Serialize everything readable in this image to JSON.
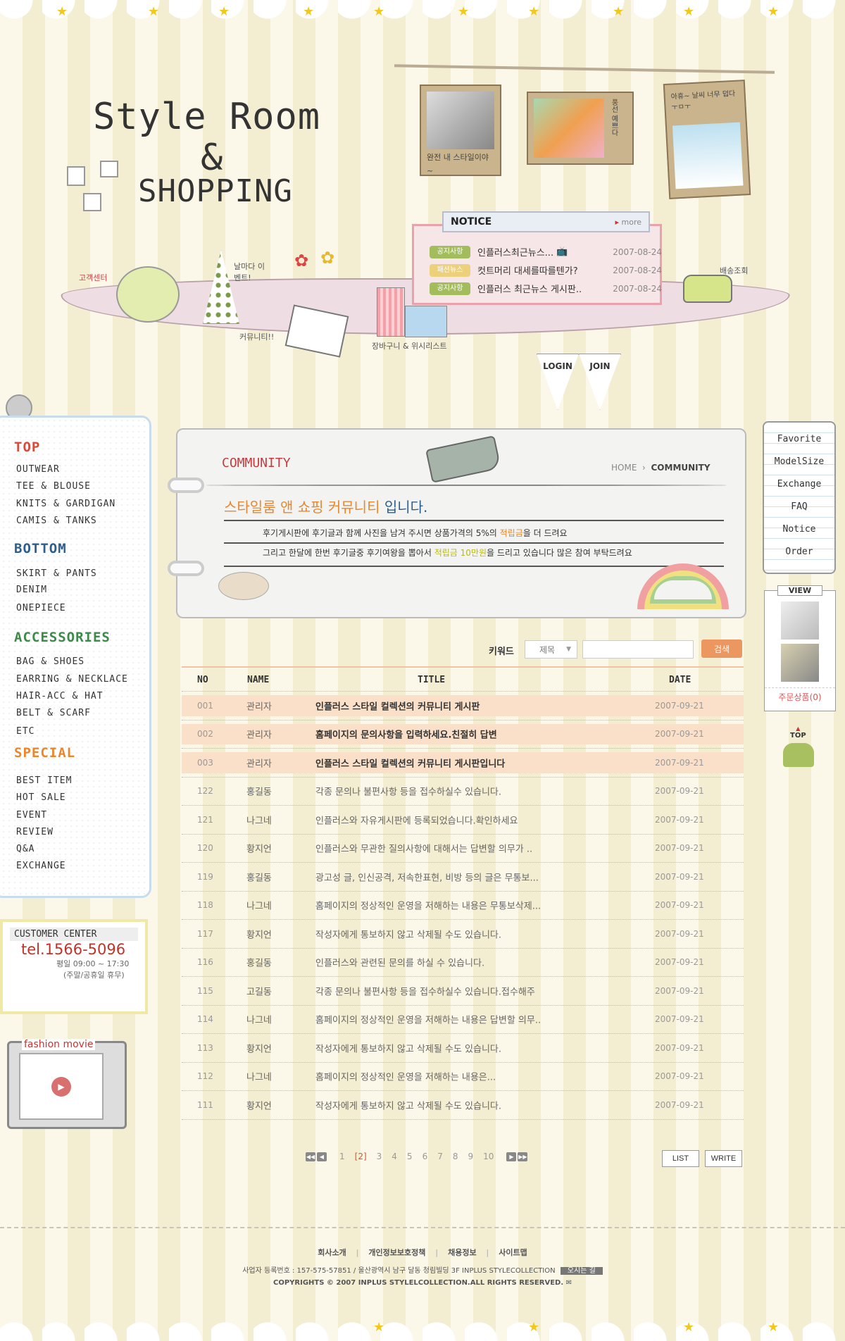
{
  "header": {
    "title_line1": "Style Room",
    "title_line2": "&",
    "title_line3": "SHOPPING",
    "photo_captions": [
      "완전 내 스타일이야~",
      "풍선 예쁘다",
      "아휴~ 날씨 너무 덥다 ㅜㅁㅜ"
    ],
    "doodles": {
      "customer_center": "고객센터",
      "event": "날마다 이벤트!",
      "community": "커뮤니티!!",
      "cart": "장바구니 & 위시리스트",
      "delivery": "배송조회"
    },
    "login": "LOGIN",
    "join": "JOIN"
  },
  "notice": {
    "title": "NOTICE",
    "more": "more",
    "items": [
      {
        "tag": "공지사항",
        "tag_color": "#a3bd5c",
        "text": "인플러스최근뉴스...",
        "date": "2007-08-24"
      },
      {
        "tag": "패션뉴스",
        "tag_color": "#ecd07a",
        "text": "컷트머리 대세를따를텐가?",
        "date": "2007-08-24"
      },
      {
        "tag": "공지사항",
        "tag_color": "#a3bd5c",
        "text": "인플러스 최근뉴스 게시판..",
        "date": "2007-08-24"
      }
    ]
  },
  "sidebar": {
    "top": {
      "label": "TOP",
      "items": [
        "OUTWEAR",
        "TEE & BLOUSE",
        "KNITS & GARDIGAN",
        "CAMIS & TANKS"
      ]
    },
    "bottom": {
      "label": "BOTTOM",
      "items": [
        "SKIRT & PANTS",
        "DENIM",
        "ONEPIECE"
      ]
    },
    "accessories": {
      "label": "ACCESSORIES",
      "items": [
        "BAG & SHOES",
        "EARRING & NECKLACE",
        "HAIR-ACC & HAT",
        "BELT & SCARF",
        "ETC"
      ]
    },
    "special": {
      "label": "SPECIAL",
      "items": [
        "BEST ITEM",
        "HOT SALE",
        "EVENT",
        "REVIEW",
        "Q&A",
        "EXCHANGE"
      ]
    }
  },
  "customer_center": {
    "title": "CUSTOMER CENTER",
    "tel": "tel.1566-5096",
    "hours": "평일 09:00 ~ 17:30",
    "closed": "(주말/공휴일 휴무)"
  },
  "movie": {
    "title": "fashion movie"
  },
  "community": {
    "title": "COMMUNITY",
    "breadcrumb_home": "HOME",
    "breadcrumb_current": "COMMUNITY",
    "headline_a": "스타일룸 앤 쇼핑 커뮤니티",
    "headline_b": " 입니다.",
    "desc1_a": "후기게시판에 후기글과 함께 사진을 남겨 주시면 상품가격의 5%의 ",
    "desc1_b": "적립금",
    "desc1_c": "을 더 드려요",
    "desc2_a": "그리고 한달에 한번 후기글중 후기여왕을 뽑아서 ",
    "desc2_b": "적립금 10만원",
    "desc2_c": "을 드리고 있습니다 많은 참여 부탁드려요"
  },
  "search": {
    "label": "키워드",
    "select_value": "제목",
    "input_value": "",
    "button": "검색"
  },
  "table": {
    "headers": {
      "no": "NO",
      "name": "NAME",
      "title": "TITLE",
      "date": "DATE"
    },
    "rows": [
      {
        "no": "001",
        "name": "관리자",
        "title": "인플러스 스타일 컬렉션의 커뮤니티 게시판",
        "date": "2007-09-21",
        "notice": true
      },
      {
        "no": "002",
        "name": "관리자",
        "title": "홈페이지의 문의사항을 입력하세요.친절히 답변",
        "date": "2007-09-21",
        "notice": true
      },
      {
        "no": "003",
        "name": "관리자",
        "title": "인플러스 스타일 컬렉션의 커뮤니티 게시판입니다",
        "date": "2007-09-21",
        "notice": true
      },
      {
        "no": "122",
        "name": "홍길동",
        "title": "각종 문의나 불편사항 등을 접수하실수 있습니다.",
        "date": "2007-09-21"
      },
      {
        "no": "121",
        "name": "나그네",
        "title": "인플러스와 자유게시판에 등록되었습니다.확인하세요",
        "date": "2007-09-21"
      },
      {
        "no": "120",
        "name": "황지언",
        "title": "인플러스와 무관한 질의사항에 대해서는 답변할 의무가 ..",
        "date": "2007-09-21"
      },
      {
        "no": "119",
        "name": "홍길동",
        "title": "광고성 글, 인신공격, 저속한표현, 비방 등의 글은 무통보...",
        "date": "2007-09-21"
      },
      {
        "no": "118",
        "name": "나그네",
        "title": "홈페이지의 정상적인 운영을 저해하는 내용은 무통보삭제...",
        "date": "2007-09-21"
      },
      {
        "no": "117",
        "name": "황지언",
        "title": "작성자에게 통보하지 않고 삭제될 수도 있습니다.",
        "date": "2007-09-21"
      },
      {
        "no": "116",
        "name": "홍길동",
        "title": "인플러스와 관련된 문의를 하실 수 있습니다.",
        "date": "2007-09-21"
      },
      {
        "no": "115",
        "name": "고길동",
        "title": "각종 문의나 불편사항 등을 접수하실수 있습니다.접수해주",
        "date": "2007-09-21"
      },
      {
        "no": "114",
        "name": "나그네",
        "title": "홈페이지의 정상적인 운영을 저해하는 내용은 답변할 의무..",
        "date": "2007-09-21"
      },
      {
        "no": "113",
        "name": "황지언",
        "title": "작성자에게 통보하지 않고 삭제될 수도 있습니다.",
        "date": "2007-09-21"
      },
      {
        "no": "112",
        "name": "나그네",
        "title": "홈페이지의 정상적인 운영을 저해하는 내용은...",
        "date": "2007-09-21"
      },
      {
        "no": "111",
        "name": "황지언",
        "title": "작성자에게 통보하지 않고 삭제될 수도 있습니다.",
        "date": "2007-09-21"
      }
    ]
  },
  "pagination": {
    "first": "◀◀",
    "prev": "◀",
    "pages": [
      "1",
      "[2]",
      "3",
      "4",
      "5",
      "6",
      "7",
      "8",
      "9",
      "10"
    ],
    "current": "[2]",
    "next": "▶",
    "last": "▶▶"
  },
  "buttons": {
    "list": "LIST",
    "write": "WRITE"
  },
  "quick_menu": {
    "items": [
      "Favorite",
      "ModelSize",
      "Exchange",
      "FAQ",
      "Notice",
      "Order"
    ],
    "view_title": "VIEW",
    "cart_label": "주문상품(0)",
    "top": "TOP"
  },
  "footer": {
    "links": [
      "회사소개",
      "개인정보보호정책",
      "채용정보",
      "사이트맵"
    ],
    "address": "사업자 등록번호 : 157-575-57851 / 울산광역시 남구 달동 청림빌딩 3F INPLUS STYLECOLLECTION",
    "directions": "오시는 길",
    "copyright": "COPYRIGHTS © 2007 INPLUS STYLELCOLLECTION.ALL RIGHTS RESERVED."
  },
  "colors": {
    "accent": "#ec9660",
    "highlight_row": "#fae0c8",
    "top_cat": "#d94a3c",
    "bottom_cat": "#2e5e8a",
    "accessories_cat": "#3e8a4a",
    "special_cat": "#e8872e"
  }
}
